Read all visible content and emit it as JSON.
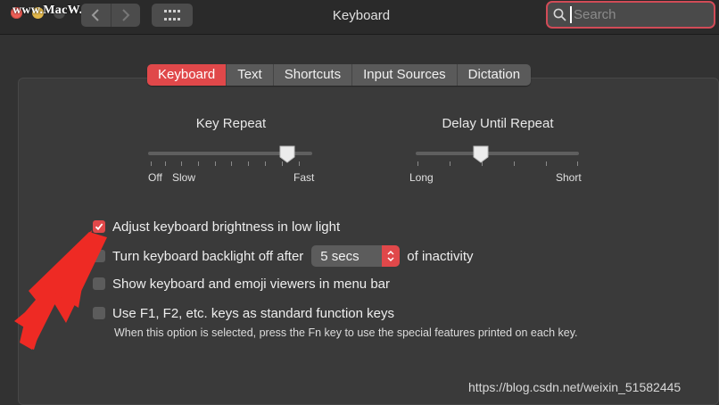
{
  "window": {
    "title": "Keyboard",
    "watermark": "www.MacW.com"
  },
  "toolbar": {
    "back_icon": "chevron-left-icon",
    "forward_icon": "chevron-right-icon",
    "show_all_icon": "grid-icon"
  },
  "search": {
    "placeholder": "Search",
    "value": ""
  },
  "tabs": [
    {
      "label": "Keyboard",
      "active": true
    },
    {
      "label": "Text",
      "active": false
    },
    {
      "label": "Shortcuts",
      "active": false
    },
    {
      "label": "Input Sources",
      "active": false
    },
    {
      "label": "Dictation",
      "active": false
    }
  ],
  "key_repeat": {
    "label": "Key Repeat",
    "min_label_1": "Off",
    "min_label_2": "Slow",
    "max_label": "Fast",
    "level": 0.85
  },
  "delay_until_repeat": {
    "label": "Delay Until Repeat",
    "min_label": "Long",
    "max_label": "Short",
    "level": 0.4
  },
  "options": {
    "brightness": {
      "label": "Adjust keyboard brightness in low light",
      "checked": true
    },
    "backlight": {
      "label_before": "Turn keyboard backlight off after",
      "select_value": "5 secs",
      "label_after": "of inactivity",
      "checked": false
    },
    "viewers": {
      "label": "Show keyboard and emoji viewers in menu bar",
      "checked": false
    },
    "fn_keys": {
      "label": "Use F1, F2, etc. keys as standard function keys",
      "help": "When this option is selected, press the Fn key to use the special features printed on each key.",
      "checked": false
    }
  },
  "credit": "https://blog.csdn.net/weixin_51582445",
  "colors": {
    "accent": "#e0484a",
    "annotation_arrow": "#ee2a24"
  }
}
